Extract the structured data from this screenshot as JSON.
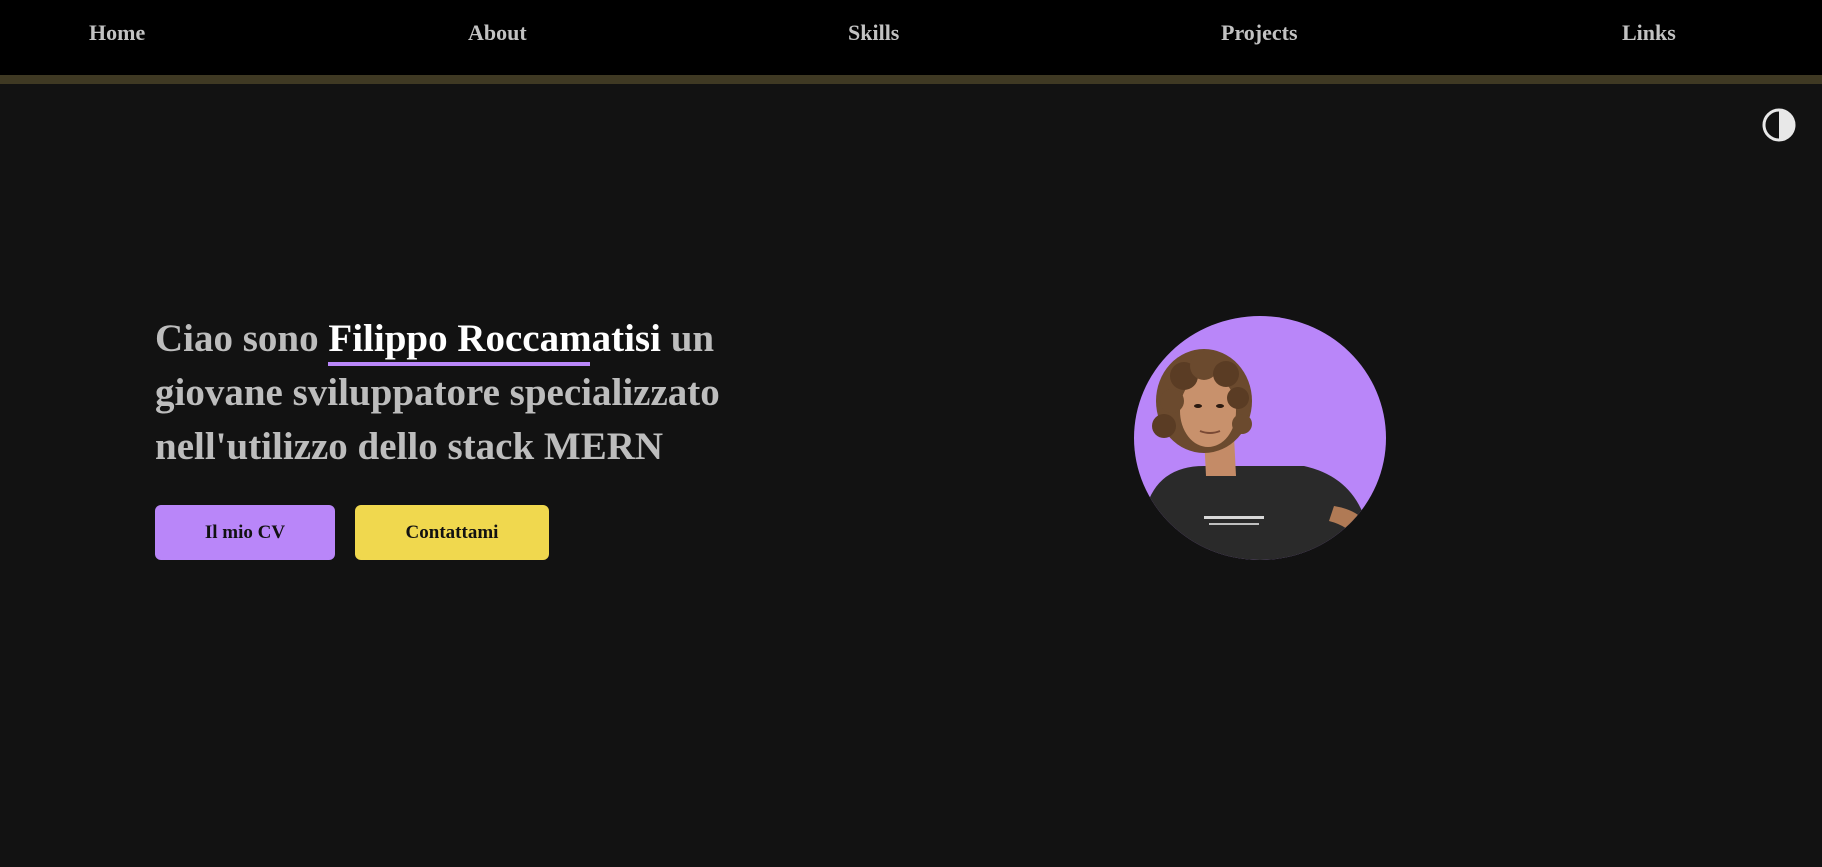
{
  "nav": {
    "items": [
      {
        "label": "Home"
      },
      {
        "label": "About"
      },
      {
        "label": "Skills"
      },
      {
        "label": "Projects"
      },
      {
        "label": "Links"
      }
    ]
  },
  "theme_toggle": {
    "icon": "contrast-half-circle-icon"
  },
  "hero": {
    "greeting": "Ciao sono ",
    "name": "Filippo Roccamatisi",
    "line1_tail": " un",
    "line2": "giovane sviluppatore specializzato",
    "line3": "nell'utilizzo dello stack MERN"
  },
  "buttons": {
    "cv_label": "Il mio CV",
    "contact_label": "Contattami"
  },
  "colors": {
    "accent_purple": "#b986f9",
    "accent_yellow": "#f0d84e",
    "background": "#121212",
    "nav_background": "#000000",
    "nav_border": "#3f3923"
  },
  "avatar": {
    "icon": "profile-photo"
  }
}
